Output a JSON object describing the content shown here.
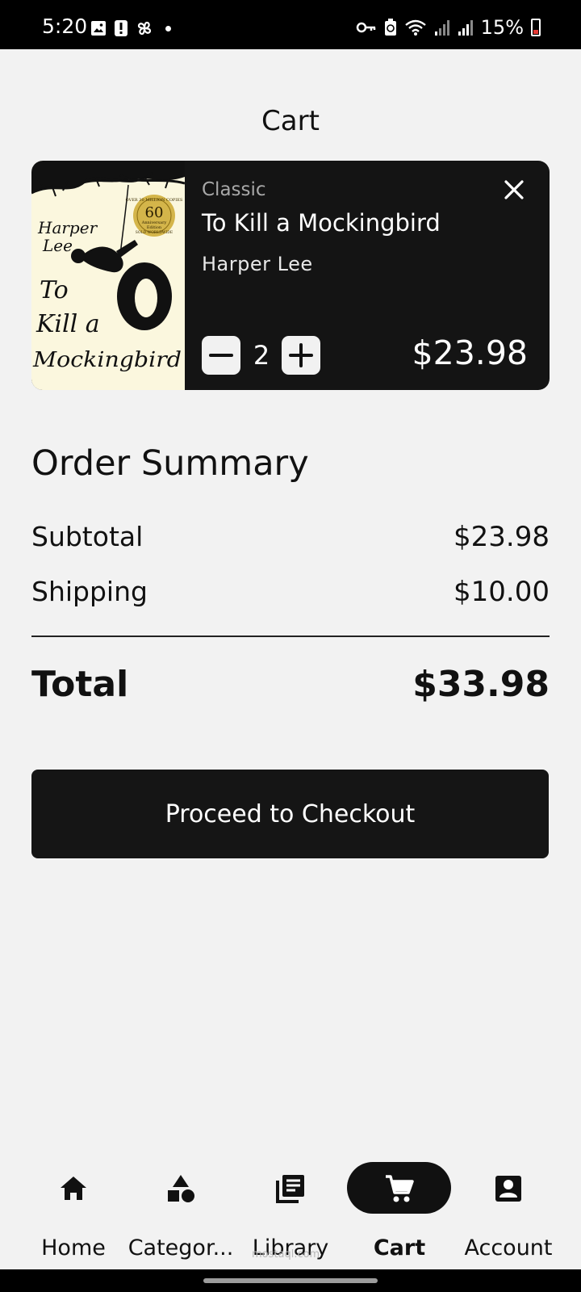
{
  "status_bar": {
    "time": "5:20",
    "battery": "15%",
    "left_icons": [
      "image-icon",
      "alert-icon",
      "pinwheel-icon",
      "dot-icon"
    ],
    "right_icons": [
      "key-icon",
      "battery-saver-icon",
      "wifi-icon",
      "signal-icon",
      "signal-icon"
    ]
  },
  "header": {
    "title": "Cart"
  },
  "cart_item": {
    "category": "Classic",
    "title": "To Kill a Mockingbird",
    "author": "Harper Lee",
    "quantity": "2",
    "price": "$23.98",
    "cover_text": {
      "author_line1": "Harper",
      "author_line2": "Lee",
      "title_line1": "To",
      "title_line2": "Kill a",
      "title_line3": "Mockingbird",
      "badge_number": "60",
      "badge_top": "OVER 30 MILLION COPIES",
      "badge_mid": "Anniversary",
      "badge_mid2": "Edition",
      "badge_bottom": "SOLD WORLDWIDE"
    }
  },
  "summary": {
    "title": "Order Summary",
    "subtotal_label": "Subtotal",
    "subtotal_value": "$23.98",
    "shipping_label": "Shipping",
    "shipping_value": "$10.00",
    "total_label": "Total",
    "total_value": "$33.98"
  },
  "checkout": {
    "label": "Proceed to Checkout"
  },
  "nav": {
    "items": [
      {
        "label": "Home",
        "icon": "home-icon"
      },
      {
        "label": "Categor...",
        "icon": "categories-icon"
      },
      {
        "label": "Library",
        "icon": "library-icon"
      },
      {
        "label": "Cart",
        "icon": "cart-icon",
        "active": true
      },
      {
        "label": "Account",
        "icon": "account-icon"
      }
    ]
  },
  "watermark": "mostaql.com",
  "colors": {
    "accent": "#111111",
    "background": "#f2f2f2",
    "card": "#141414"
  }
}
